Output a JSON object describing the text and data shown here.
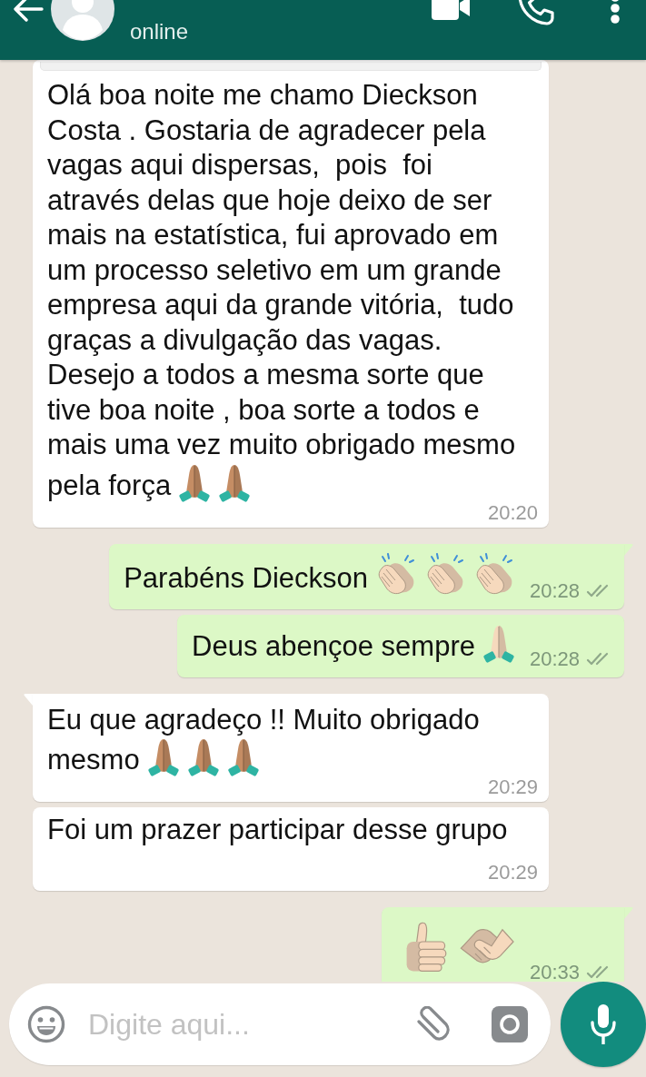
{
  "header": {
    "status": "online"
  },
  "messages": [
    {
      "kind": "received",
      "tail": false,
      "quoted": true,
      "lines": [
        "Olá boa noite me chamo Dieckson",
        "Costa . Gostaria de agradecer pela",
        "vagas aqui dispersas,  pois  foi",
        "através delas que hoje deixo de ser",
        "mais na estatística, fui aprovado em",
        "um processo seletivo em um grande",
        "empresa aqui da grande vitória,  tudo",
        "graças a divulgação das vagas.",
        "Desejo a todos a mesma sorte que",
        "tive boa noite , boa sorte a todos e",
        "mais uma vez muito obrigado mesmo",
        "pela força"
      ],
      "emojis": [
        {
          "kind": "praying-hands",
          "color": "#c58d64"
        },
        {
          "kind": "praying-hands",
          "color": "#c58d64"
        }
      ],
      "time": "20:20"
    },
    {
      "kind": "sent",
      "tail": true,
      "lines": [
        "Parabéns Dieckson"
      ],
      "emojis": [
        {
          "kind": "clapping-hands",
          "color": "#f6d9bd"
        },
        {
          "kind": "clapping-hands",
          "color": "#f6d9bd"
        },
        {
          "kind": "clapping-hands",
          "color": "#f6d9bd"
        }
      ],
      "time": "20:28",
      "read": false
    },
    {
      "kind": "sent",
      "tail": false,
      "lines": [
        "Deus abençoe sempre"
      ],
      "emojis": [
        {
          "kind": "praying-hands",
          "color": "#f6d9bd"
        }
      ],
      "time": "20:28",
      "read": false
    },
    {
      "kind": "received",
      "tail": true,
      "lines": [
        "Eu que agradeço !! Muito obrigado",
        "mesmo"
      ],
      "emojis": [
        {
          "kind": "praying-hands",
          "color": "#c58d64"
        },
        {
          "kind": "praying-hands",
          "color": "#c58d64"
        },
        {
          "kind": "praying-hands",
          "color": "#c58d64"
        }
      ],
      "time": "20:29"
    },
    {
      "kind": "received",
      "tail": false,
      "lines": [
        "Foi um prazer participar desse grupo"
      ],
      "time": "20:29"
    },
    {
      "kind": "sent",
      "tail": true,
      "emojis": [
        {
          "kind": "thumbs-up",
          "color": "#f6d9bd"
        },
        {
          "kind": "handshake",
          "color": "#f6d9bd"
        }
      ],
      "time": "20:33",
      "read": false
    }
  ],
  "composer": {
    "placeholder": "Digite aqui..."
  }
}
